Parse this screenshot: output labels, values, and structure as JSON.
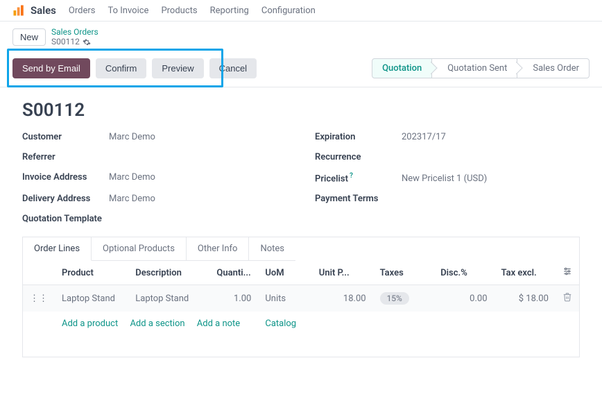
{
  "nav": {
    "brand": "Sales",
    "items": [
      "Orders",
      "To Invoice",
      "Products",
      "Reporting",
      "Configuration"
    ]
  },
  "breadcrumb": {
    "new_button": "New",
    "parent": "Sales Orders",
    "current": "S00112"
  },
  "actions": {
    "send_email": "Send by Email",
    "confirm": "Confirm",
    "preview": "Preview",
    "cancel": "Cancel"
  },
  "stages": {
    "quotation": "Quotation",
    "quotation_sent": "Quotation Sent",
    "sales_order": "Sales Order"
  },
  "doc": {
    "title": "S00112",
    "labels": {
      "customer": "Customer",
      "referrer": "Referrer",
      "invoice_address": "Invoice Address",
      "delivery_address": "Delivery Address",
      "quotation_template": "Quotation Template",
      "expiration": "Expiration",
      "recurrence": "Recurrence",
      "pricelist": "Pricelist",
      "payment_terms": "Payment Terms"
    },
    "values": {
      "customer": "Marc Demo",
      "referrer": "",
      "invoice_address": "Marc Demo",
      "delivery_address": "Marc Demo",
      "quotation_template": "",
      "expiration": "202317/17",
      "recurrence": "",
      "pricelist": "New Pricelist 1 (USD)",
      "payment_terms": ""
    },
    "help": "?"
  },
  "tabs": {
    "order_lines": "Order Lines",
    "optional_products": "Optional Products",
    "other_info": "Other Info",
    "notes": "Notes"
  },
  "columns": {
    "product": "Product",
    "description": "Description",
    "quantity": "Quanti...",
    "uom": "UoM",
    "unit_price": "Unit P...",
    "taxes": "Taxes",
    "disc": "Disc.%",
    "tax_excl": "Tax excl."
  },
  "lines": [
    {
      "product": "Laptop Stand",
      "description": "Laptop Stand",
      "quantity": "1.00",
      "uom": "Units",
      "unit_price": "18.00",
      "taxes": "15%",
      "disc": "0.00",
      "tax_excl": "$ 18.00"
    }
  ],
  "add": {
    "product": "Add a product",
    "section": "Add a section",
    "note": "Add a note",
    "catalog": "Catalog"
  }
}
